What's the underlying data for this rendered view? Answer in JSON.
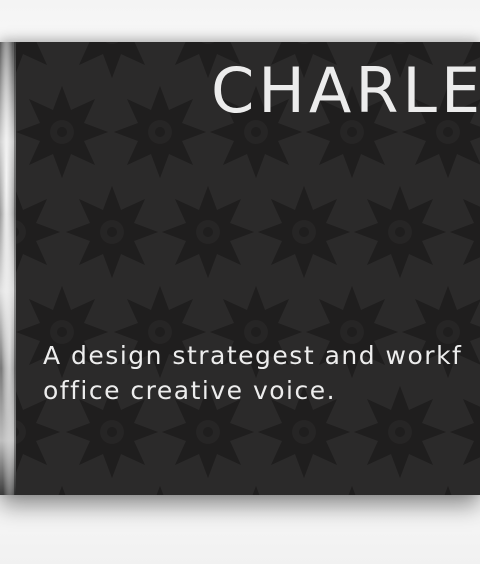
{
  "hero": {
    "title": "CHARLE",
    "tagline_line1": "A design strategest and workf",
    "tagline_line2": "office creative voice."
  },
  "colors": {
    "panel_background": "#2b2a2a",
    "star_pattern": "#1f1e1e",
    "text": "#ececec"
  },
  "icons": {
    "pattern": "starburst-icon"
  }
}
